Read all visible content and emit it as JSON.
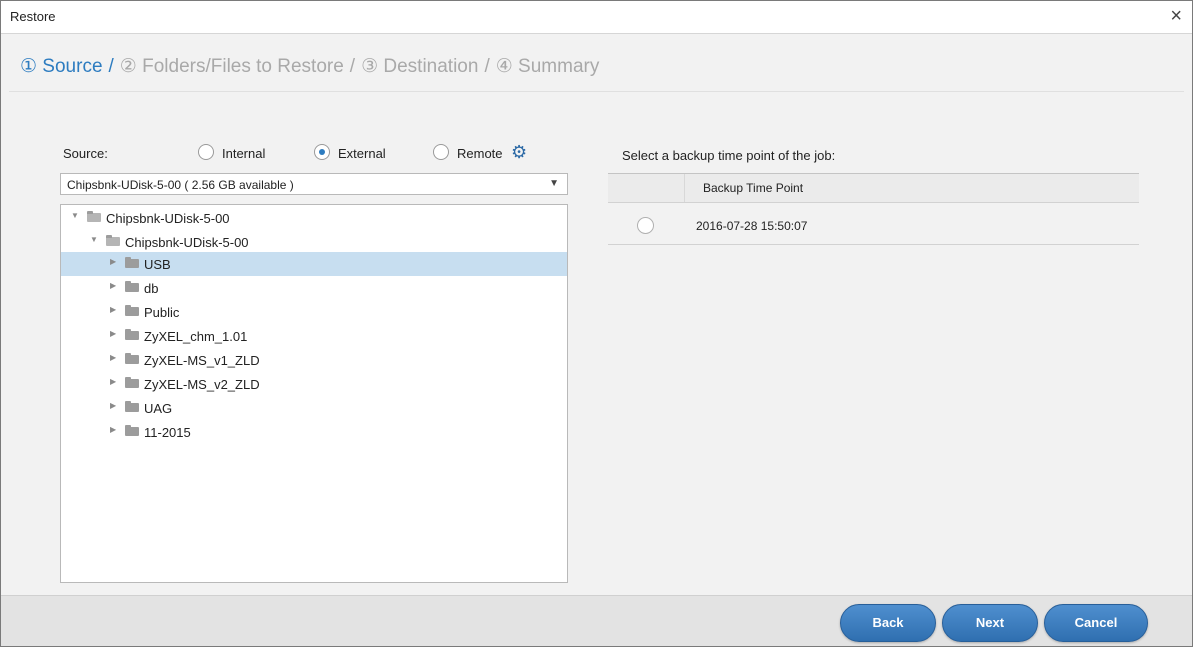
{
  "dialog": {
    "title": "Restore",
    "close_label": "×"
  },
  "steps": [
    {
      "label": "① Source",
      "active": true
    },
    {
      "label": "② Folders/Files to Restore",
      "active": false
    },
    {
      "label": "③ Destination",
      "active": false
    },
    {
      "label": "④ Summary",
      "active": false
    }
  ],
  "step_separator": "/",
  "source": {
    "label": "Source:",
    "options": [
      {
        "label": "Internal",
        "selected": false
      },
      {
        "label": "External",
        "selected": true
      },
      {
        "label": "Remote",
        "selected": false
      }
    ],
    "settings_icon": "gear-icon",
    "device_select": "Chipsbnk-UDisk-5-00 ( 2.56 GB available )"
  },
  "tree": [
    {
      "label": "Chipsbnk-UDisk-5-00",
      "level": 0,
      "expanded": true,
      "selected": false
    },
    {
      "label": "Chipsbnk-UDisk-5-00",
      "level": 1,
      "expanded": true,
      "selected": false
    },
    {
      "label": "USB",
      "level": 2,
      "expanded": false,
      "selected": true
    },
    {
      "label": "db",
      "level": 2,
      "expanded": false,
      "selected": false
    },
    {
      "label": "Public",
      "level": 2,
      "expanded": false,
      "selected": false
    },
    {
      "label": "ZyXEL_chm_1.01",
      "level": 2,
      "expanded": false,
      "selected": false
    },
    {
      "label": "ZyXEL-MS_v1_ZLD",
      "level": 2,
      "expanded": false,
      "selected": false
    },
    {
      "label": "ZyXEL-MS_v2_ZLD",
      "level": 2,
      "expanded": false,
      "selected": false
    },
    {
      "label": "UAG",
      "level": 2,
      "expanded": false,
      "selected": false
    },
    {
      "label": "11-2015",
      "level": 2,
      "expanded": false,
      "selected": false
    }
  ],
  "backup": {
    "title": "Select a backup time point of the job:",
    "column_header": "Backup Time Point",
    "rows": [
      {
        "time_point": "2016-07-28 15:50:07",
        "selected": false
      }
    ]
  },
  "buttons": {
    "back": "Back",
    "next": "Next",
    "cancel": "Cancel"
  },
  "colors": {
    "accent": "#2d7cc0",
    "selection": "#c7def0",
    "button": "#3b7cc0"
  }
}
